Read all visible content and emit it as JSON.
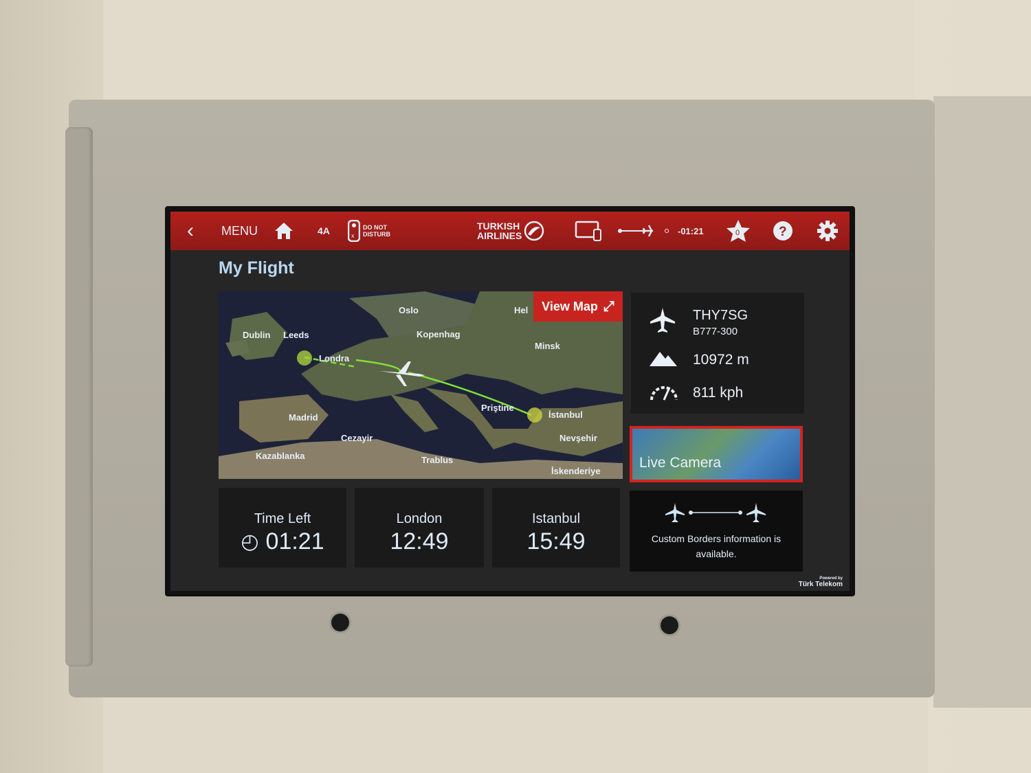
{
  "topbar": {
    "back_icon": "chevron-left-icon",
    "menu": "MENU",
    "home_icon": "home-icon",
    "seat": "4A",
    "dnd_line1": "DO NOT",
    "dnd_line2": "DISTURB",
    "brand_line1": "TURKISH",
    "brand_line2": "AIRLINES",
    "flight_time_remaining": "-01:21",
    "favorites_count": "0",
    "help_icon": "question-icon",
    "settings_icon": "gear-icon"
  },
  "page": {
    "title": "My Flight"
  },
  "map": {
    "view_map": "View Map",
    "cities": [
      "Oslo",
      "Hel",
      "Kopenhag",
      "Dublin",
      "Leeds",
      "Londra",
      "Minsk",
      "Priştine",
      "İstanbul",
      "Madrid",
      "Cezayir",
      "Nevşehir",
      "Kazablanka",
      "Trablus",
      "İskenderiye"
    ]
  },
  "flight": {
    "callsign": "THY7SG",
    "aircraft": "B777-300",
    "altitude": "10972 m",
    "speed": "811 kph"
  },
  "live_camera": {
    "label": "Live Camera"
  },
  "cards": {
    "time_left_label": "Time Left",
    "time_left": "01:21",
    "origin": "London",
    "origin_time": "12:49",
    "destination": "Istanbul",
    "destination_time": "15:49"
  },
  "borders": {
    "text": "Custom Borders information is available."
  },
  "footer": {
    "powered": "Powered by",
    "brand": "Türk Telekom"
  },
  "colors": {
    "accent": "#b2201c",
    "route": "#7ee03a",
    "title": "#b9d8f0"
  }
}
